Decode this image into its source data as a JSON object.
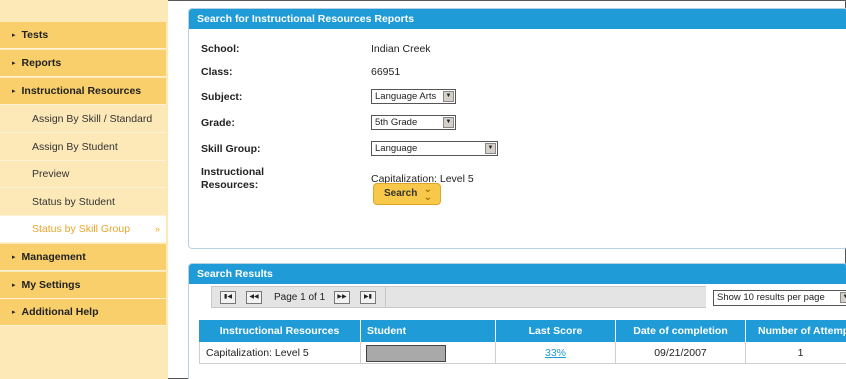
{
  "sidebar": {
    "items": [
      {
        "label": "Tests",
        "type": "main"
      },
      {
        "label": "Reports",
        "type": "main"
      },
      {
        "label": "Instructional Resources",
        "type": "main"
      },
      {
        "label": "Assign By Skill / Standard",
        "type": "sub"
      },
      {
        "label": "Assign By Student",
        "type": "sub"
      },
      {
        "label": "Preview",
        "type": "sub"
      },
      {
        "label": "Status by Student",
        "type": "sub"
      },
      {
        "label": "Status by Skill Group",
        "type": "sub-active"
      },
      {
        "label": "Management",
        "type": "main"
      },
      {
        "label": "My Settings",
        "type": "main"
      },
      {
        "label": "Additional Help",
        "type": "main"
      }
    ],
    "arrow_glyph": "▸",
    "active_glyph": "»"
  },
  "search_panel": {
    "title": "Search for Instructional Resources Reports",
    "school_label": "School:",
    "school_value": "Indian Creek",
    "class_label": "Class:",
    "class_value": "66951",
    "subject_label": "Subject:",
    "subject_value": "Language Arts",
    "grade_label": "Grade:",
    "grade_value": "5th Grade",
    "skill_group_label": "Skill Group:",
    "skill_group_value": "Language",
    "resources_label_1": "Instructional",
    "resources_label_2": "Resources:",
    "resources_value": "Capitalization: Level 5",
    "search_button": "Search"
  },
  "results_panel": {
    "title": "Search Results",
    "pager": {
      "first": "▮◀",
      "prev": "◀◀",
      "page_text": "Page 1 of 1",
      "next": "▶▶",
      "last": "▶▮"
    },
    "per_page_value": "Show 10 results per page",
    "columns": [
      "Instructional Resources",
      "Student",
      "Last Score",
      "Date of completion",
      "Number of Attempts"
    ],
    "rows": [
      {
        "resource": "Capitalization: Level 5",
        "student": "",
        "last_score": "33%",
        "date": "09/21/2007",
        "attempts": "1"
      }
    ]
  },
  "colors": {
    "sidebar_main": "#f9cf6b",
    "sidebar_sub": "#fde9b8",
    "header_blue": "#1f9bd7",
    "button_gold": "#f7c84a"
  }
}
